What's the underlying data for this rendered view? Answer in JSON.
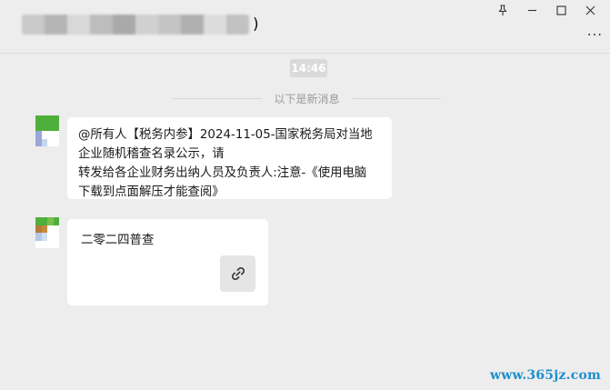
{
  "header": {
    "title_suffix": ")",
    "title_blur_colors": [
      "#c9c9c9",
      "#b5b5b5",
      "#d8d8d8",
      "#bdbdbd",
      "#a9a9a9",
      "#d0d0d0",
      "#c4c4c4",
      "#b0b0b0",
      "#dcdcdc",
      "#c2c2c2"
    ],
    "window_controls": [
      "pin-icon",
      "minimize-icon",
      "maximize-icon",
      "close-icon"
    ],
    "more_label": "..."
  },
  "chat": {
    "time": "14:46",
    "divider_label": "以下是新消息",
    "messages": [
      {
        "avatar_colors": [
          "#4eb03b",
          "#4eb03b",
          "#4eb03b",
          "#4eb03b",
          "#4eb03b",
          "#4eb03b",
          "#4eb03b",
          "#4eb03b",
          "#9aa7d9",
          "#ffffff",
          "#ffffff",
          "#ffffff",
          "#9aa7d9",
          "#c7d6ef",
          "#ffffff",
          "#ffffff"
        ],
        "lines": [
          "@所有人【税务内参】2024-11-05-国家税务局对当地",
          "企业随机稽查名录公示，请",
          "转发给各企业财务出纳人员及负责人:注意-《使用电脑",
          "下载到点面解压才能查阅》"
        ]
      },
      {
        "avatar_colors": [
          "#4eb03b",
          "#4eb03b",
          "#7abf4a",
          "#4eb03b",
          "#b47a3a",
          "#c58b3d",
          "#ffffff",
          "#ffffff",
          "#b6c7e6",
          "#d2dff3",
          "#ffffff",
          "#ffffff",
          "#ffffff",
          "#ffffff",
          "#ffffff",
          "#ffffff"
        ],
        "text": "二零二四普查",
        "link_icon": "link-icon"
      }
    ]
  },
  "watermark": "www.365jz.com"
}
